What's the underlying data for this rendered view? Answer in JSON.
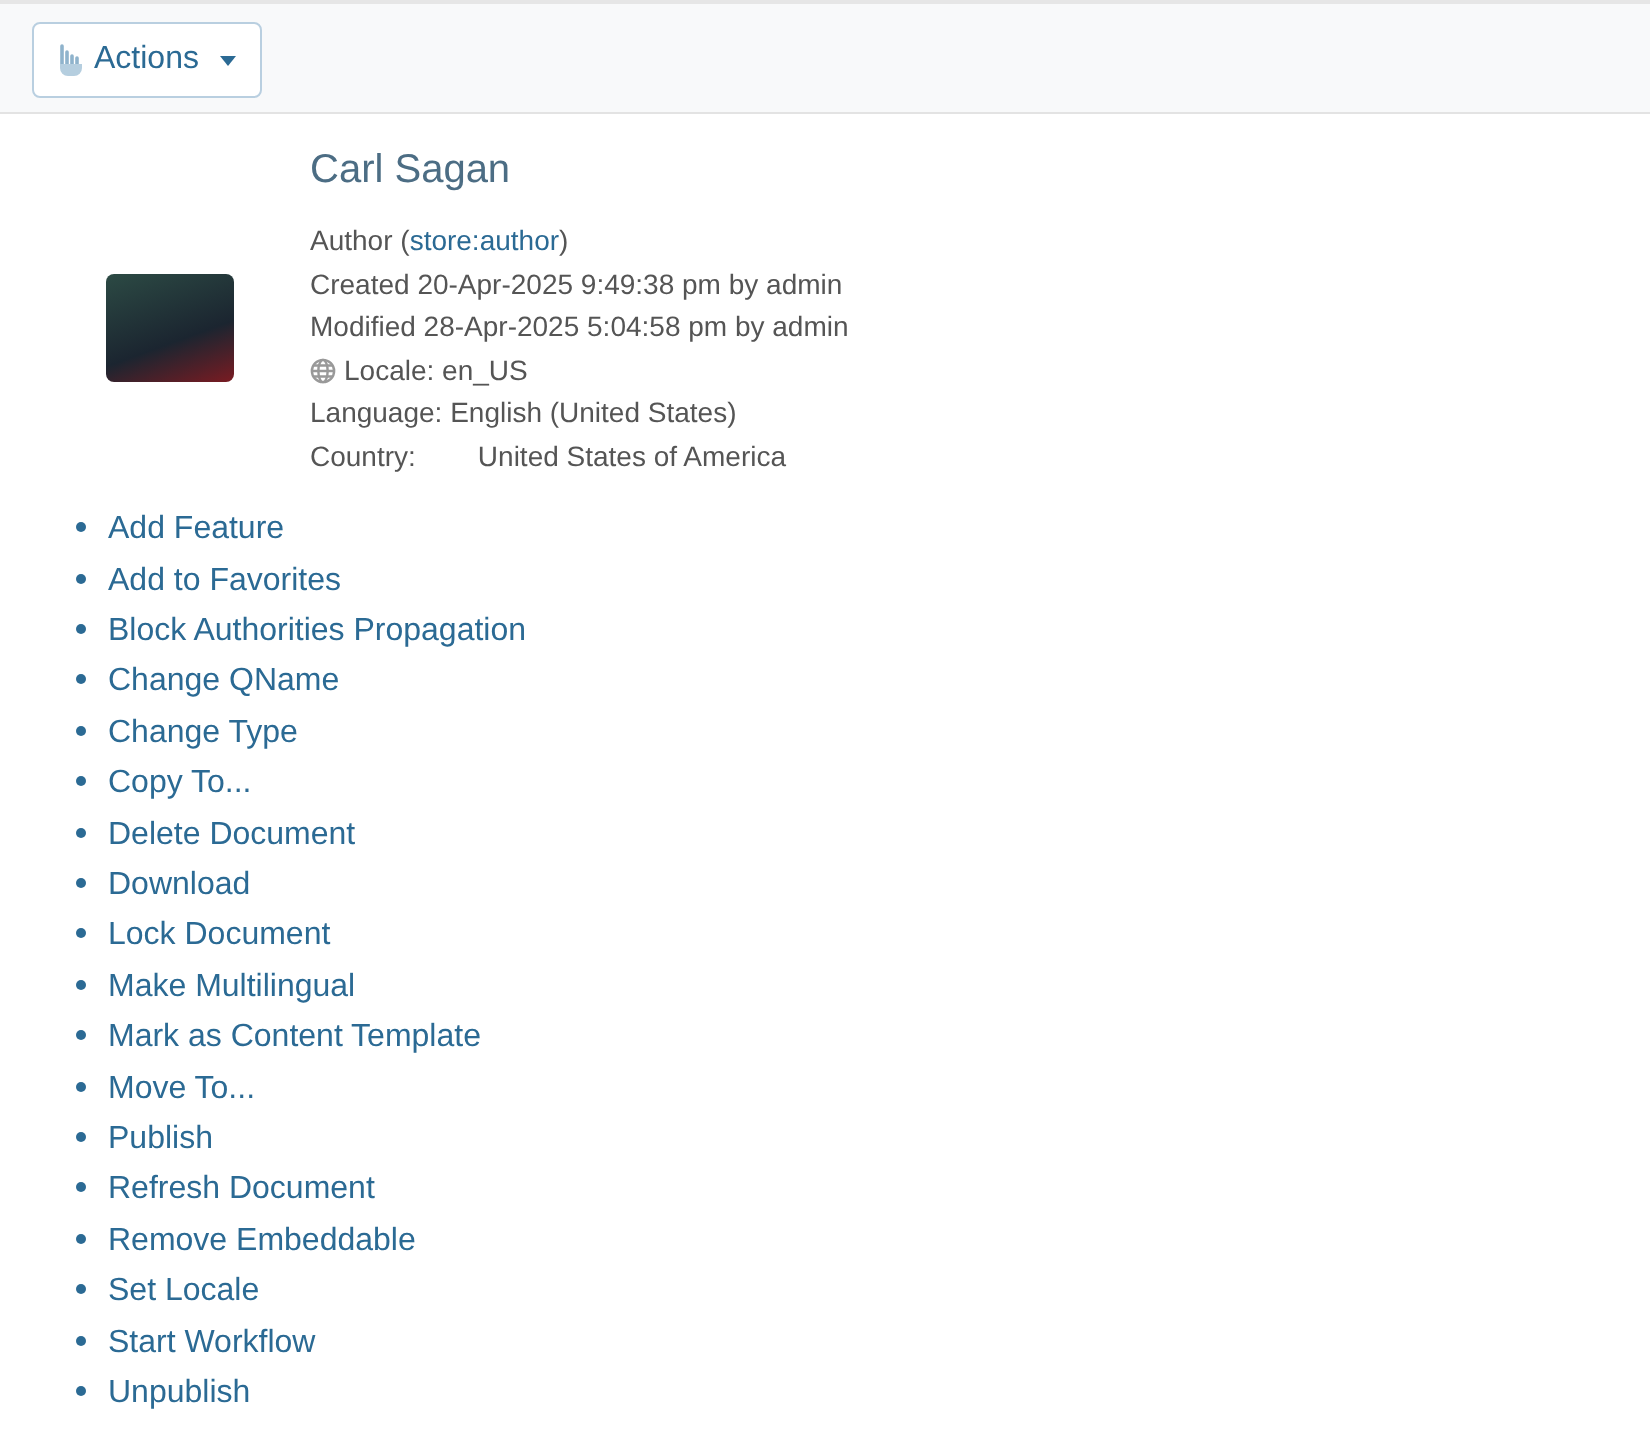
{
  "toolbar": {
    "actions_button": {
      "label": "Actions"
    }
  },
  "profile": {
    "name": "Carl Sagan",
    "type": {
      "prefix": "Author (",
      "link": "store:author",
      "suffix": ")"
    },
    "created": "Created 20-Apr-2025 9:49:38 pm by admin",
    "modified": "Modified 28-Apr-2025 5:04:58 pm by admin",
    "locale": "Locale: en_US",
    "language": "Language: English (United States)",
    "country_label": "Country:",
    "country_value": "United States of America"
  },
  "actions": [
    "Add Feature",
    "Add to Favorites",
    "Block Authorities Propagation",
    "Change QName",
    "Change Type",
    "Copy To...",
    "Delete Document",
    "Download",
    "Lock Document",
    "Make Multilingual",
    "Mark as Content Template",
    "Move To...",
    "Publish",
    "Refresh Document",
    "Remove Embeddable",
    "Set Locale",
    "Start Workflow",
    "Unpublish"
  ]
}
